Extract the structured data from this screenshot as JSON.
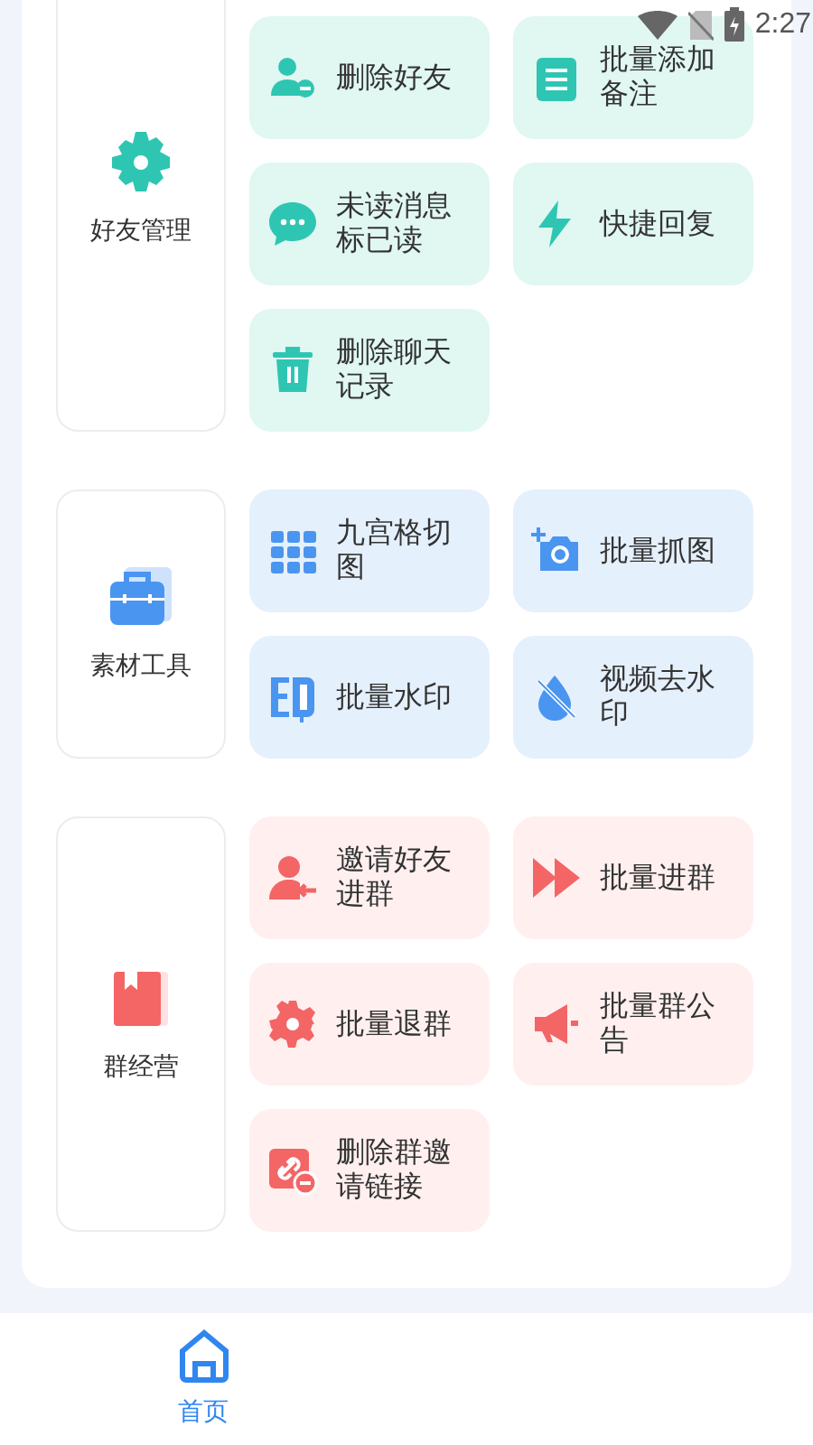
{
  "status_bar": {
    "time": "2:27"
  },
  "sections": [
    {
      "kind": "teal",
      "title": "好友管理",
      "tiles": [
        {
          "kind": "person-minus",
          "label": "删除好友"
        },
        {
          "kind": "note",
          "label": "批量添加备注"
        },
        {
          "kind": "chat",
          "label": "未读消息标已读"
        },
        {
          "kind": "bolt",
          "label": "快捷回复"
        },
        {
          "kind": "trash",
          "label": "删除聊天记录"
        }
      ]
    },
    {
      "kind": "blue",
      "title": "素材工具",
      "tiles": [
        {
          "kind": "grid",
          "label": "九宫格切图"
        },
        {
          "kind": "camera",
          "label": "批量抓图"
        },
        {
          "kind": "stamp",
          "label": "批量水印"
        },
        {
          "kind": "drop",
          "label": "视频去水印"
        }
      ]
    },
    {
      "kind": "red",
      "title": "群经营",
      "tiles": [
        {
          "kind": "person-arrow",
          "label": "邀请好友进群"
        },
        {
          "kind": "fast-forward",
          "label": "批量进群"
        },
        {
          "kind": "gear",
          "label": "批量退群"
        },
        {
          "kind": "megaphone",
          "label": "批量群公告"
        },
        {
          "kind": "link-minus",
          "label": "删除群邀请链接"
        }
      ]
    }
  ],
  "nav": [
    {
      "label": "首页",
      "selected": true
    }
  ]
}
